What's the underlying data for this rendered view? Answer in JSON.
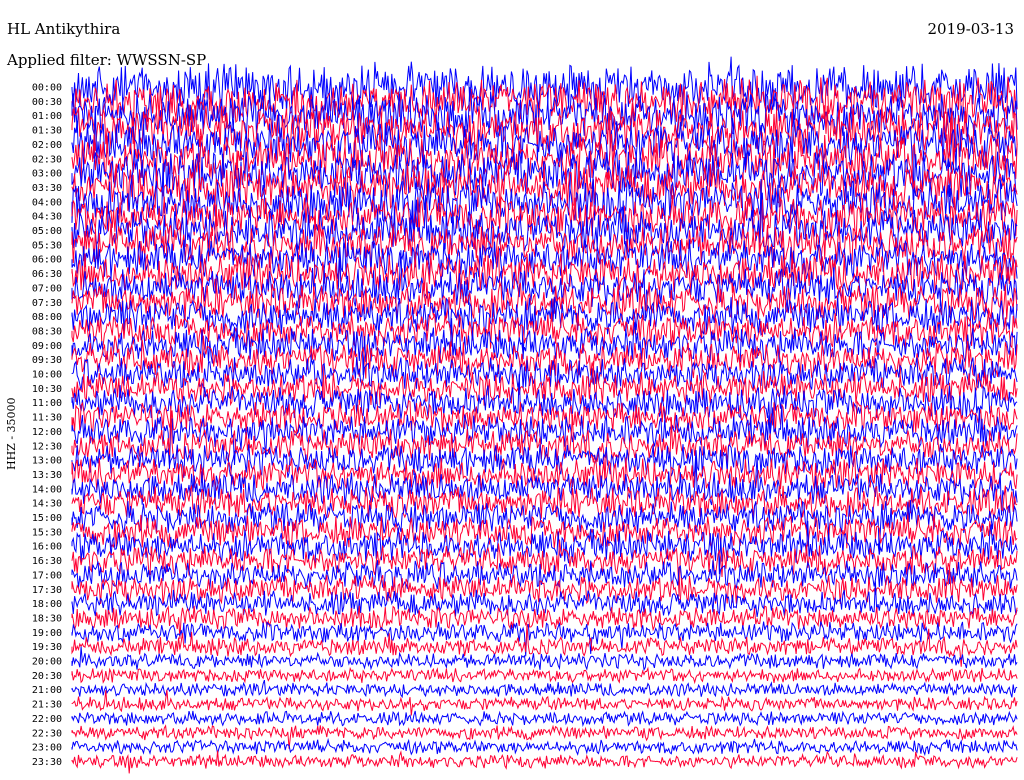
{
  "header": {
    "station": "HL Antikythira",
    "date": "2019-03-13",
    "filter": "Applied filter: WWSSN-SP"
  },
  "channel_label": "HHZ - 35000",
  "colors": {
    "trace_a": "#0000ff",
    "trace_b": "#ff0033"
  },
  "chart_data": {
    "type": "line",
    "title": "HL Antikythira",
    "subtitle": "Applied filter: WWSSN-SP",
    "ylabel": "HHZ - 35000",
    "xlabel": "",
    "row_labels": [
      "00:00",
      "00:30",
      "01:00",
      "01:30",
      "02:00",
      "02:30",
      "03:00",
      "03:30",
      "04:00",
      "04:30",
      "05:00",
      "05:30",
      "06:00",
      "06:30",
      "07:00",
      "07:30",
      "08:00",
      "08:30",
      "09:00",
      "09:30",
      "10:00",
      "10:30",
      "11:00",
      "11:30",
      "12:00",
      "12:30",
      "13:00",
      "13:30",
      "14:00",
      "14:30",
      "15:00",
      "15:30",
      "16:00",
      "16:30",
      "17:00",
      "17:30",
      "18:00",
      "18:30",
      "19:00",
      "19:30",
      "20:00",
      "20:30",
      "21:00",
      "21:30",
      "22:00",
      "22:30",
      "23:00",
      "23:30"
    ],
    "relative_amplitude": [
      1.0,
      1.0,
      1.0,
      1.0,
      1.0,
      1.0,
      1.0,
      0.95,
      0.95,
      0.9,
      0.9,
      0.9,
      0.85,
      0.85,
      0.8,
      0.8,
      0.8,
      0.75,
      0.75,
      0.75,
      0.7,
      0.7,
      0.7,
      0.7,
      0.7,
      0.7,
      0.7,
      0.7,
      0.7,
      0.7,
      0.7,
      0.7,
      0.7,
      0.65,
      0.6,
      0.6,
      0.55,
      0.5,
      0.45,
      0.4,
      0.35,
      0.3,
      0.3,
      0.3,
      0.3,
      0.3,
      0.3,
      0.3
    ],
    "trace_colors": [
      "blue",
      "red"
    ]
  }
}
